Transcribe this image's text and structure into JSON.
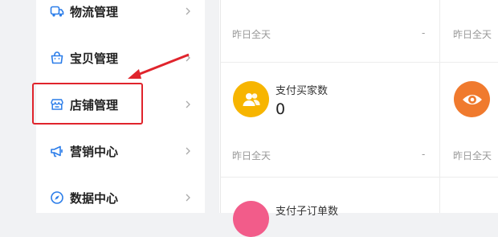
{
  "sidebar": {
    "items": [
      {
        "label": "物流管理",
        "icon": "truck-icon"
      },
      {
        "label": "宝贝管理",
        "icon": "shopping-bag-icon"
      },
      {
        "label": "店铺管理",
        "icon": "store-icon"
      },
      {
        "label": "营销中心",
        "icon": "megaphone-icon"
      },
      {
        "label": "数据中心",
        "icon": "compass-icon"
      }
    ]
  },
  "main": {
    "period_label": "昨日全天",
    "period_label_right": "昨日全天",
    "dash": "-",
    "metrics": [
      {
        "title": "支付买家数",
        "value": "0",
        "icon": "users-icon",
        "color": "#f7b500"
      },
      {
        "title": "支付子订单数",
        "icon": "order-icon",
        "color": "#f25c8a"
      }
    ],
    "right_metric": {
      "icon": "eye-icon",
      "color": "#f07a2e"
    }
  },
  "colors": {
    "accent_red": "#e0242c",
    "icon_blue": "#2b7de9"
  }
}
